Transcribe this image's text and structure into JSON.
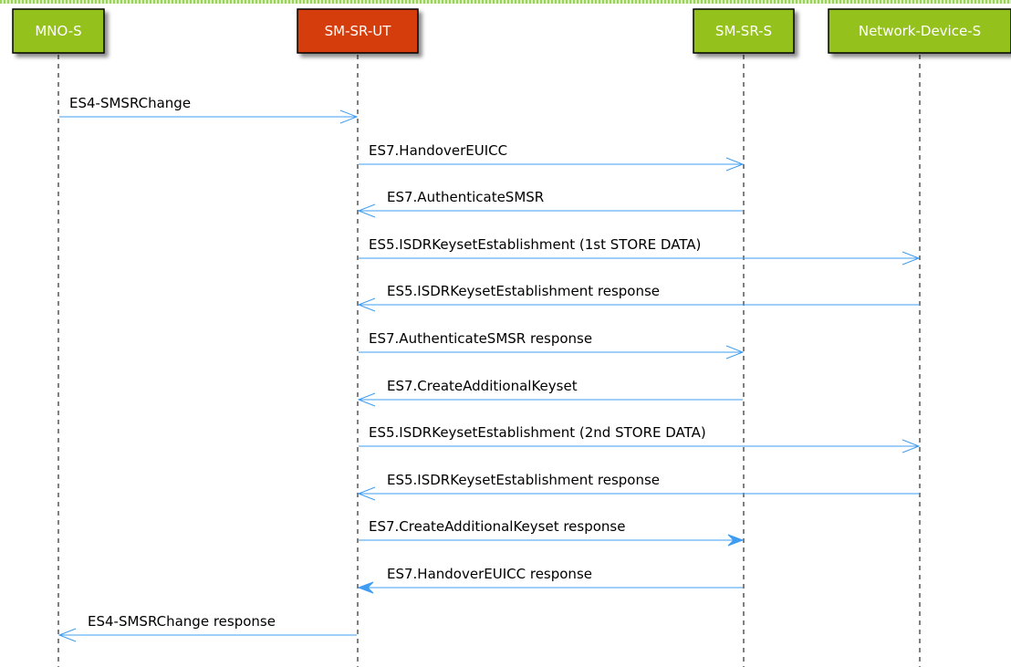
{
  "participants": [
    {
      "id": "mno",
      "label": "MNO-S",
      "color": "#94c11f"
    },
    {
      "id": "smsrut",
      "label": "SM-SR-UT",
      "color": "#d63e0c"
    },
    {
      "id": "smsrs",
      "label": "SM-SR-S",
      "color": "#94c11f"
    },
    {
      "id": "nds",
      "label": "Network-Device-S",
      "color": "#94c11f"
    }
  ],
  "messages": [
    {
      "from": "mno",
      "to": "smsrut",
      "label": "ES4-SMSRChange",
      "arrow": "open"
    },
    {
      "from": "smsrut",
      "to": "smsrs",
      "label": "ES7.HandoverEUICC",
      "arrow": "open"
    },
    {
      "from": "smsrs",
      "to": "smsrut",
      "label": "ES7.AuthenticateSMSR",
      "arrow": "open"
    },
    {
      "from": "smsrut",
      "to": "nds",
      "label": "ES5.ISDRKeysetEstablishment (1st STORE DATA)",
      "arrow": "open"
    },
    {
      "from": "nds",
      "to": "smsrut",
      "label": "ES5.ISDRKeysetEstablishment response",
      "arrow": "open"
    },
    {
      "from": "smsrut",
      "to": "smsrs",
      "label": "ES7.AuthenticateSMSR response",
      "arrow": "open"
    },
    {
      "from": "smsrs",
      "to": "smsrut",
      "label": "ES7.CreateAdditionalKeyset",
      "arrow": "open"
    },
    {
      "from": "smsrut",
      "to": "nds",
      "label": "ES5.ISDRKeysetEstablishment (2nd STORE DATA)",
      "arrow": "open"
    },
    {
      "from": "nds",
      "to": "smsrut",
      "label": "ES5.ISDRKeysetEstablishment response",
      "arrow": "open"
    },
    {
      "from": "smsrut",
      "to": "smsrs",
      "label": "ES7.CreateAdditionalKeyset response",
      "arrow": "filled"
    },
    {
      "from": "smsrs",
      "to": "smsrut",
      "label": "ES7.HandoverEUICC response",
      "arrow": "filled"
    },
    {
      "from": "smsrut",
      "to": "mno",
      "label": "ES4-SMSRChange response",
      "arrow": "open"
    }
  ],
  "colors": {
    "message_line": "#3f9cf2",
    "border_green": "#9cd15a"
  }
}
